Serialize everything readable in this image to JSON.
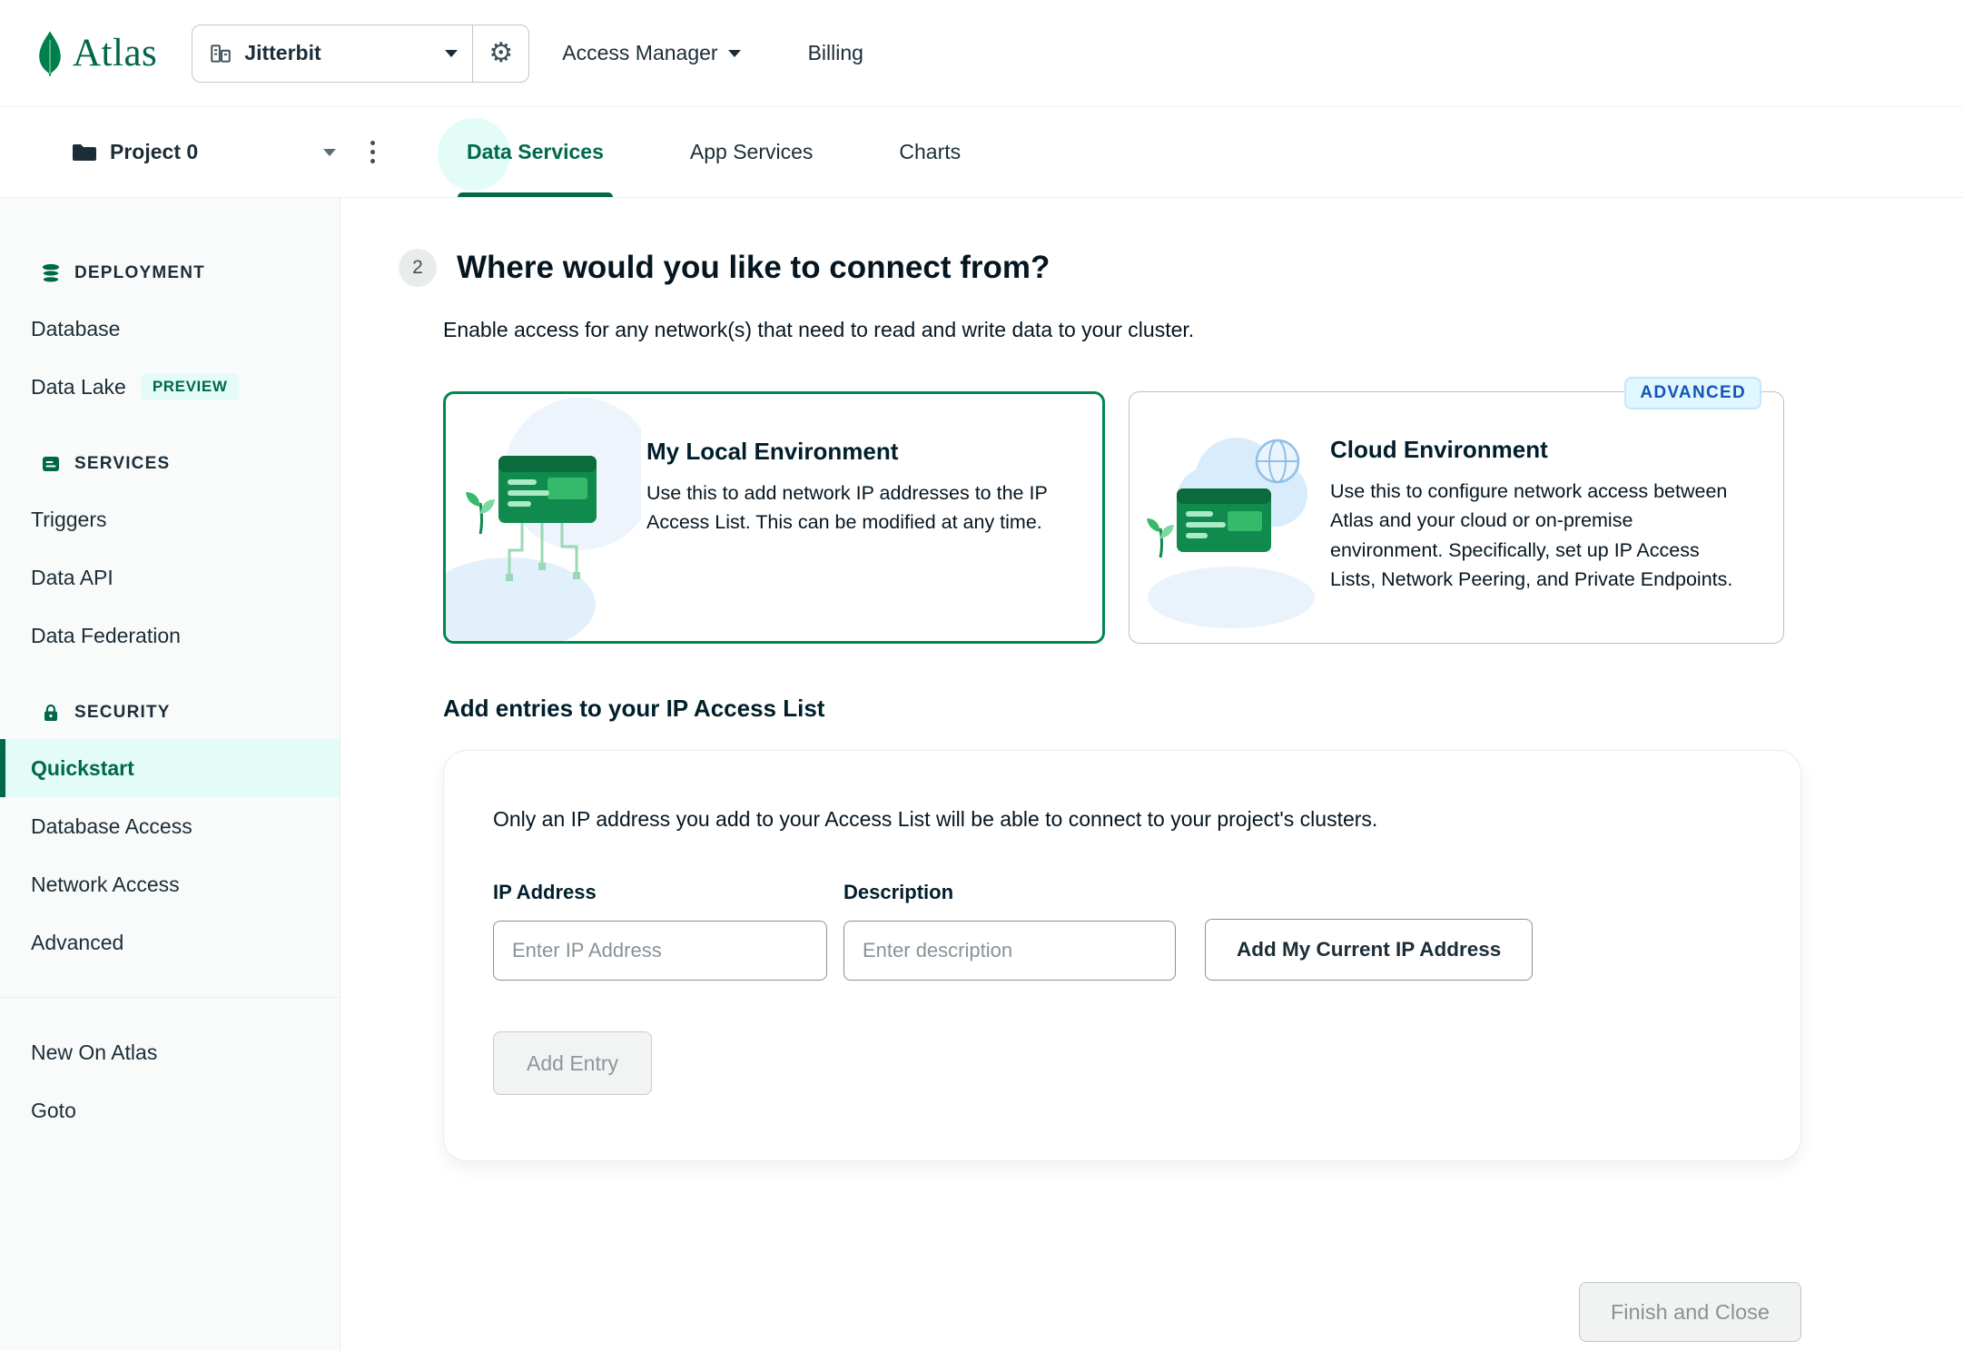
{
  "header": {
    "brand": "Atlas",
    "org_name": "Jitterbit",
    "access_manager": "Access Manager",
    "billing": "Billing"
  },
  "project_bar": {
    "project_name": "Project 0",
    "tabs": [
      {
        "label": "Data Services",
        "active": true
      },
      {
        "label": "App Services",
        "active": false
      },
      {
        "label": "Charts",
        "active": false
      }
    ]
  },
  "sidebar": {
    "sections": [
      {
        "title": "DEPLOYMENT",
        "items": [
          {
            "label": "Database"
          },
          {
            "label": "Data Lake",
            "badge": "PREVIEW"
          }
        ]
      },
      {
        "title": "SERVICES",
        "items": [
          {
            "label": "Triggers"
          },
          {
            "label": "Data API"
          },
          {
            "label": "Data Federation"
          }
        ]
      },
      {
        "title": "SECURITY",
        "items": [
          {
            "label": "Quickstart",
            "active": true
          },
          {
            "label": "Database Access"
          },
          {
            "label": "Network Access"
          },
          {
            "label": "Advanced"
          }
        ]
      }
    ],
    "footer": [
      {
        "label": "New On Atlas"
      },
      {
        "label": "Goto"
      }
    ]
  },
  "main": {
    "step": "2",
    "title": "Where would you like to connect from?",
    "subtitle": "Enable access for any network(s) that need to read and write data to your cluster.",
    "cards": [
      {
        "title": "My Local Environment",
        "description": "Use this to add network IP addresses to the IP Access List. This can be modified at any time.",
        "selected": true
      },
      {
        "title": "Cloud Environment",
        "badge": "ADVANCED",
        "description": "Use this to configure network access between Atlas and your cloud or on-premise environment. Specifically, set up IP Access Lists, Network Peering, and Private Endpoints."
      }
    ],
    "access_list": {
      "heading": "Add entries to your IP Access List",
      "note": "Only an IP address you add to your Access List will be able to connect to your project's clusters.",
      "ip_label": "IP Address",
      "desc_label": "Description",
      "ip_placeholder": "Enter IP Address",
      "desc_placeholder": "Enter description",
      "add_current_button": "Add My Current IP Address",
      "add_entry_button": "Add Entry"
    },
    "finish_button": "Finish and Close"
  },
  "colors": {
    "brand_green": "#00684A",
    "active_mint": "#E3FCF7",
    "selected_card_border": "#00884D",
    "advanced_badge_text": "#1254B7",
    "muted_text": "#889397"
  }
}
